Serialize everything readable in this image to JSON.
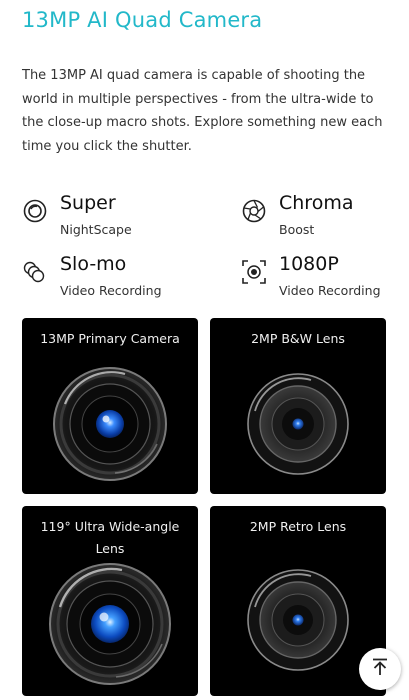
{
  "title": "13MP AI Quad Camera",
  "description": "The 13MP AI quad camera is capable of shooting the world in multiple perspectives - from the ultra-wide to the close-up macro shots. Explore something new each time you click the shutter.",
  "features": [
    {
      "title": "Super",
      "subtitle": "NightScape",
      "icon": "night-icon"
    },
    {
      "title": "Chroma",
      "subtitle": "Boost",
      "icon": "aperture-icon"
    },
    {
      "title": "Slo-mo",
      "subtitle": "Video Recording",
      "icon": "slow-motion-icon"
    },
    {
      "title": "1080P",
      "subtitle": "Video Recording",
      "icon": "video-frame-icon"
    }
  ],
  "cards": [
    {
      "label": "13MP Primary Camera"
    },
    {
      "label": "2MP B&W Lens"
    },
    {
      "label": "119° Ultra Wide-angle Lens"
    },
    {
      "label": "2MP Retro Lens"
    }
  ],
  "scroll_top_icon": "arrow-up-to-top-icon",
  "colors": {
    "title": "#22b8c9",
    "card_background": "#000000",
    "lens_blue": "#1e6fff"
  }
}
